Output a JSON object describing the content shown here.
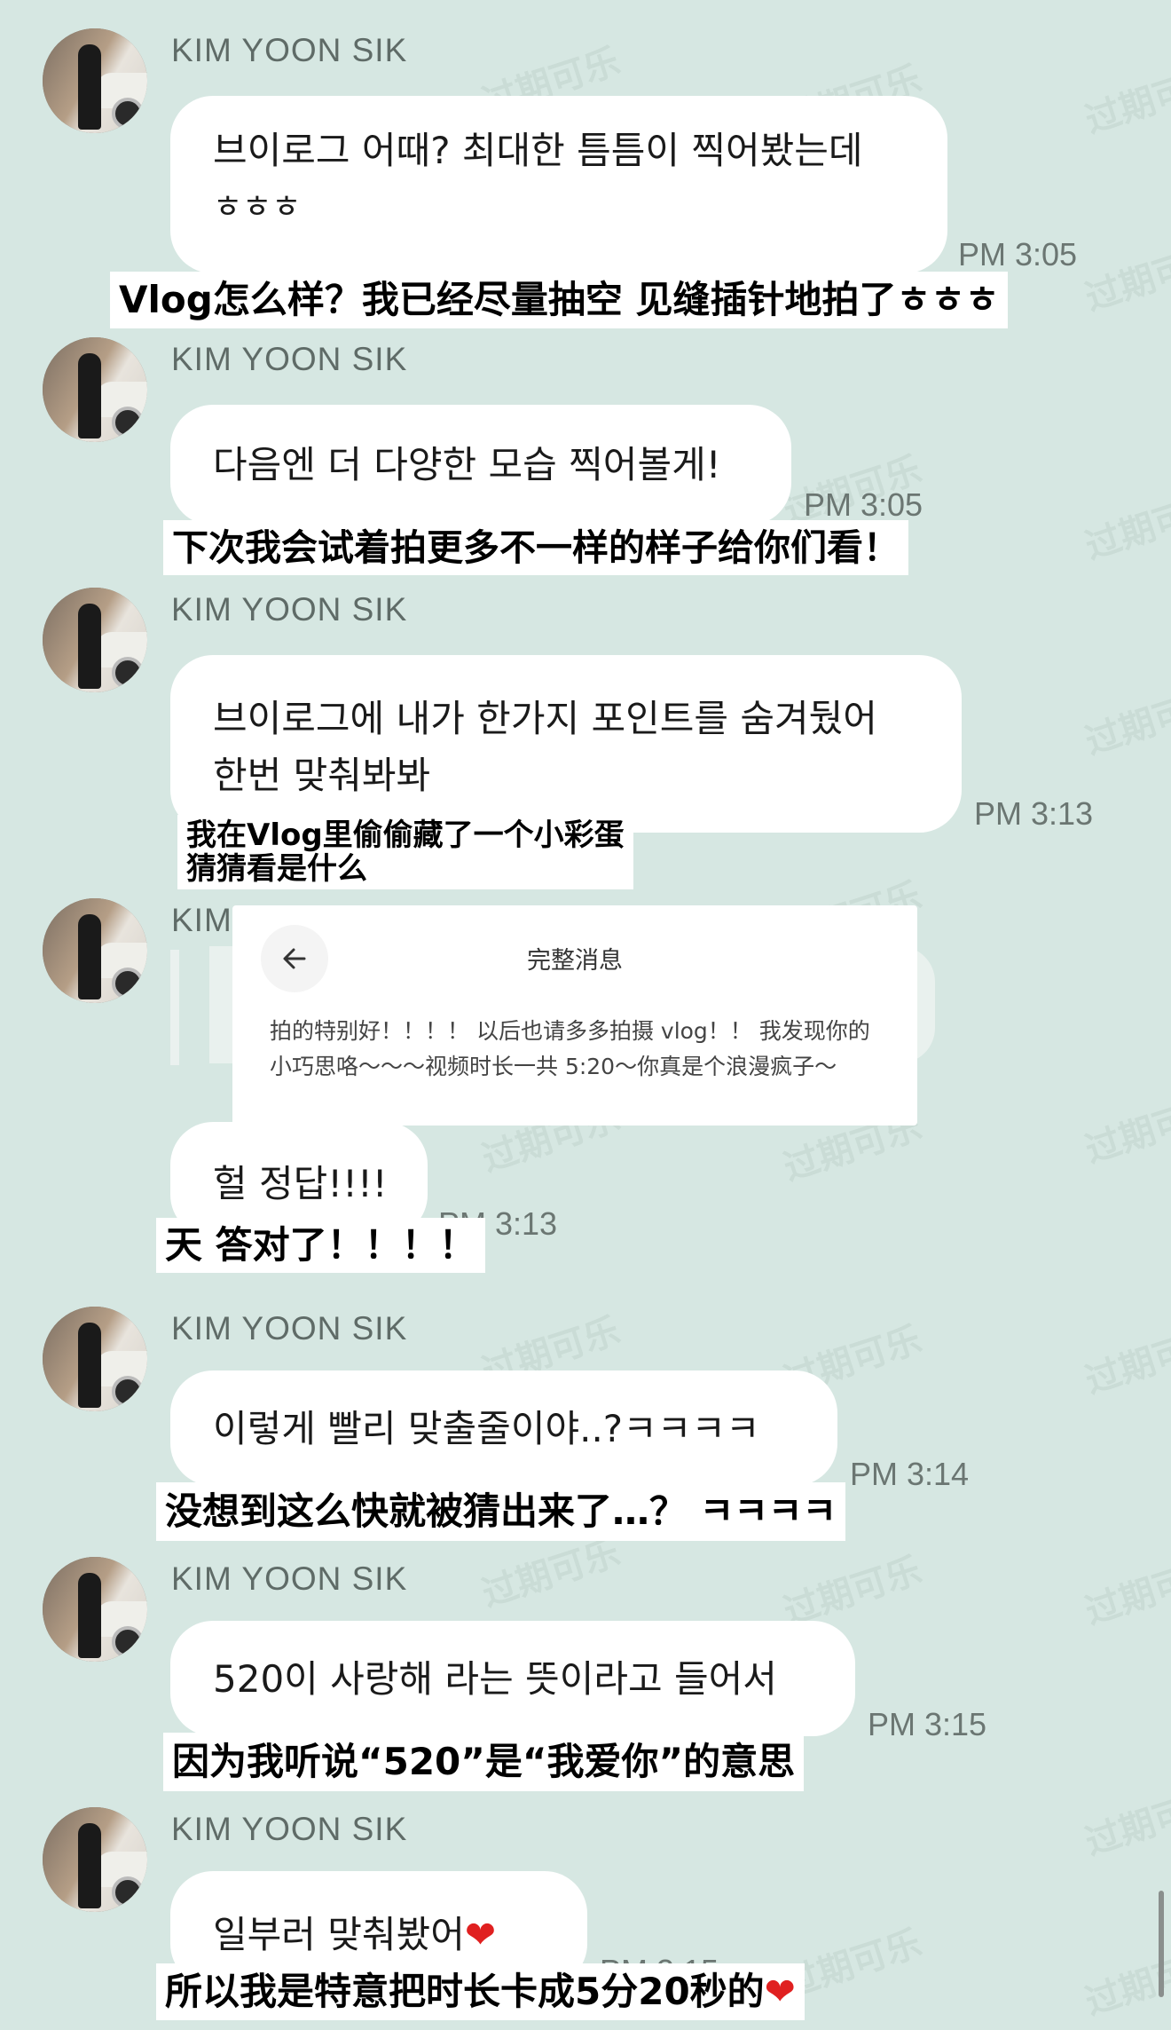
{
  "sender_name": "KIM YOON SIK",
  "watermark": "过期可乐",
  "messages": [
    {
      "korean": [
        "브이로그 어때? 최대한 틈틈이 찍어봤는데",
        "ㅎㅎㅎ"
      ],
      "time": "PM 3:05",
      "chinese": [
        "Vlog怎么样？我已经尽量抽空 见缝插针地拍了ㅎㅎㅎ"
      ]
    },
    {
      "korean": [
        "다음엔 더 다양한 모습 찍어볼게!"
      ],
      "time": "PM 3:05",
      "chinese": [
        "下次我会试着拍更多不一样的样子给你们看！"
      ]
    },
    {
      "korean": [
        "브이로그에 내가 한가지 포인트를 숨겨뒀어",
        "한번 맞춰봐봐"
      ],
      "time": "PM 3:13",
      "chinese": [
        "我在Vlog里偷偷藏了一个小彩蛋",
        "猜猜看是什么"
      ]
    },
    {
      "korean": [
        "헐 정답!!!!"
      ],
      "time": "PM 3:13",
      "chinese": [
        "天 答对了！！！！"
      ]
    },
    {
      "korean": [
        "이렇게 빨리 맞출줄이야..?ㅋㅋㅋㅋ"
      ],
      "time": "PM 3:14",
      "chinese": [
        "没想到这么快就被猜出来了…？ ㅋㅋㅋㅋ"
      ]
    },
    {
      "korean": [
        "520이 사랑해 라는 뜻이라고 들어서"
      ],
      "time": "PM 3:15",
      "chinese": [
        "因为我听说“520”是“我爱你”的意思"
      ]
    },
    {
      "korean": [
        "일부러 맞춰봤어"
      ],
      "time": "PM 3:15",
      "chinese": [
        "所以我是特意把时长卡成5分20秒的"
      ]
    }
  ],
  "full_message_panel": {
    "title": "完整消息",
    "back_icon": "back-arrow-icon",
    "body": "拍的特别好！！！！ 以后也请多多拍摄 vlog！！ 我发现你的小巧思咯～～～视频时长一共 5:20～你真是个浪漫疯子～"
  },
  "colors": {
    "background": "#d6e7e2",
    "bubble": "#ffffff",
    "heart": "#e02020"
  }
}
